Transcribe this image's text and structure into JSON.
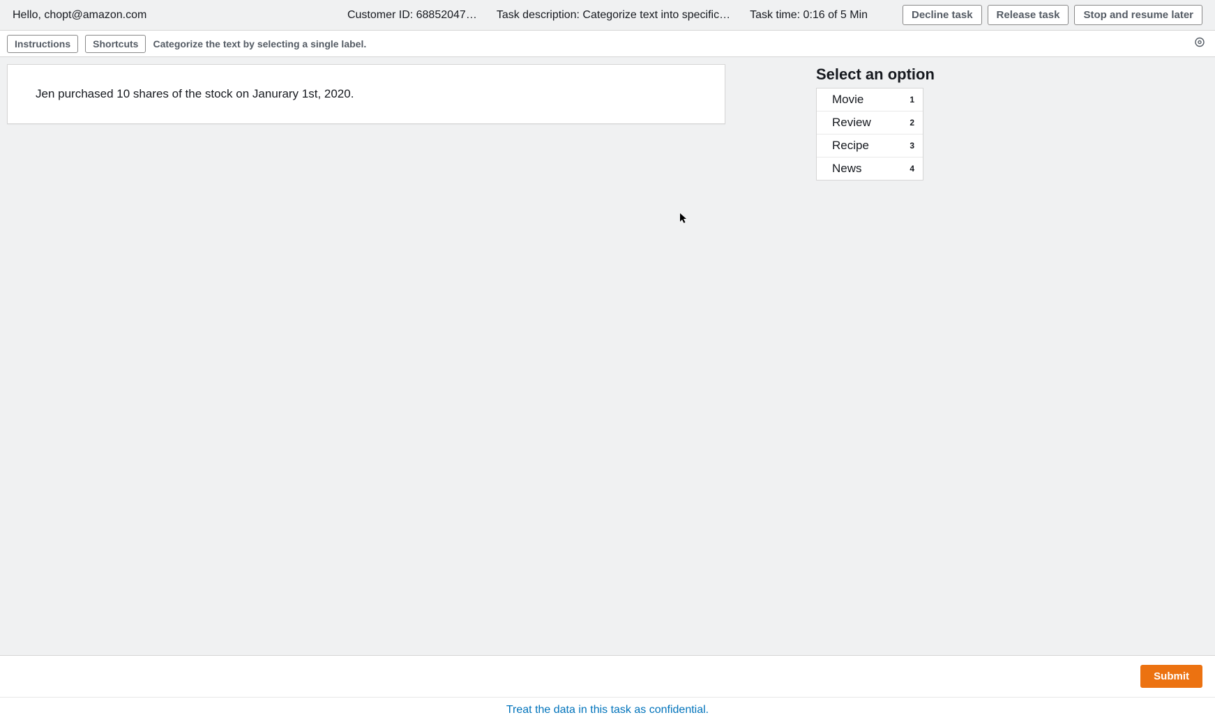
{
  "header": {
    "greeting": "Hello, chopt@amazon.com",
    "customer_id": "Customer ID: 68852047…",
    "task_desc": "Task description: Categorize text into specific…",
    "task_time": "Task time: 0:16 of 5 Min",
    "decline_label": "Decline task",
    "release_label": "Release task",
    "stop_label": "Stop and resume later"
  },
  "subbar": {
    "instructions_label": "Instructions",
    "shortcuts_label": "Shortcuts",
    "hint": "Categorize the text by selecting a single label."
  },
  "task": {
    "text": "Jen purchased 10 shares of the stock on Janurary 1st, 2020."
  },
  "options": {
    "title": "Select an option",
    "items": [
      {
        "label": "Movie",
        "shortcut": "1"
      },
      {
        "label": "Review",
        "shortcut": "2"
      },
      {
        "label": "Recipe",
        "shortcut": "3"
      },
      {
        "label": "News",
        "shortcut": "4"
      }
    ]
  },
  "footer": {
    "submit_label": "Submit",
    "confidential": "Treat the data in this task as confidential."
  }
}
